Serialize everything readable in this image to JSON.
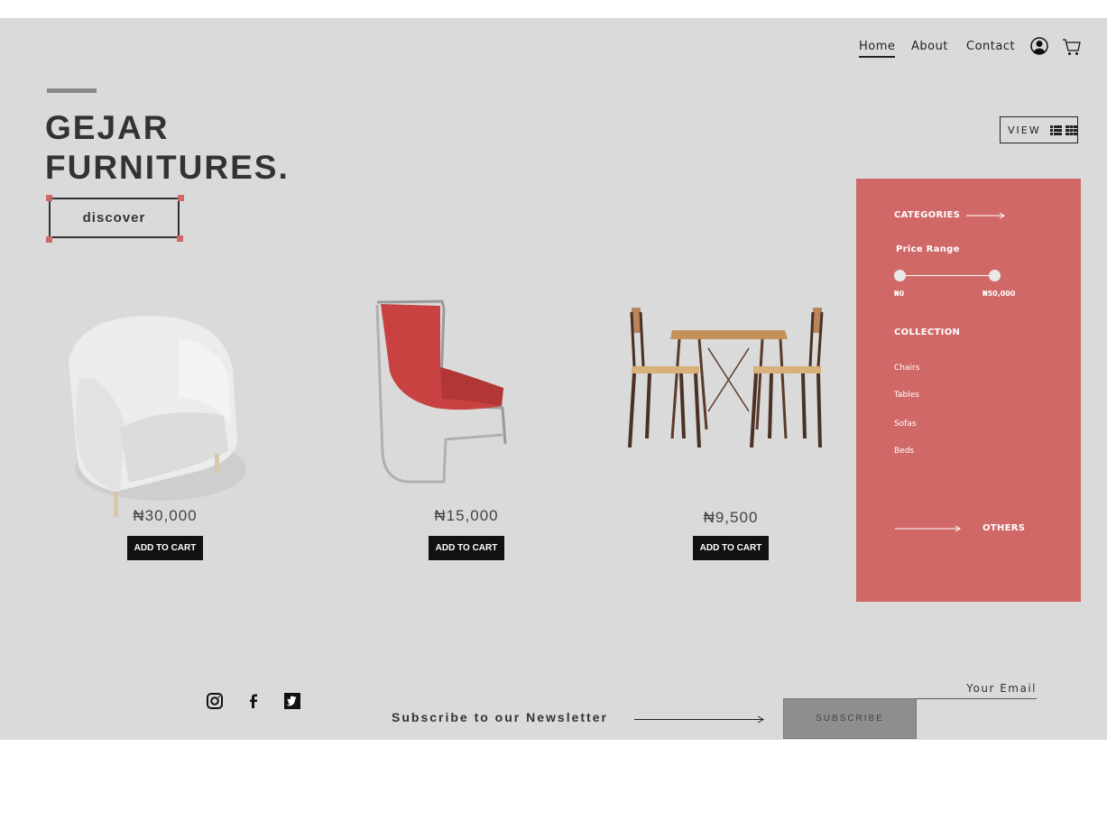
{
  "nav": {
    "home": "Home",
    "about": "About",
    "contact": "Contact"
  },
  "hero": {
    "title_line1": "GEJAR",
    "title_line2": "FURNITURES.",
    "discover_label": "discover"
  },
  "view": {
    "label": "VIEW"
  },
  "products": [
    {
      "name": "armchair",
      "price": "₦30,000",
      "button": "ADD TO CART"
    },
    {
      "name": "red-chair",
      "price": "₦15,000",
      "button": "ADD TO CART"
    },
    {
      "name": "table-set",
      "price": "₦9,500",
      "button": "ADD TO CART"
    }
  ],
  "sidebar": {
    "categories": "CATEGORIES",
    "price_range": "Price Range",
    "price_min": "₦0",
    "price_max": "₦50,000",
    "collection": "COLLECTION",
    "items": [
      "Chairs",
      "Tables",
      "Sofas",
      "Beds"
    ],
    "others": "OTHERS",
    "color": "#d16868"
  },
  "footer": {
    "newsletter": "Subscribe to our Newsletter",
    "subscribe_label": "SUBSCRIBE",
    "email_placeholder": "Your Email",
    "social_icons": [
      "instagram-icon",
      "facebook-icon",
      "twitter-icon"
    ]
  }
}
